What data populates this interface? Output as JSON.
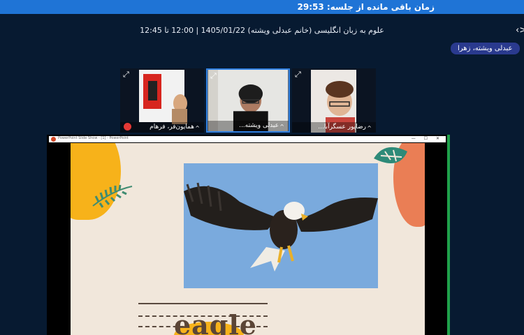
{
  "session": {
    "time_remaining": "زمان باقی مانده از جلسه: 29:53",
    "info": "علوم به زبان انگلیسی (خانم عبدلی ویشته) 1405/01/22 | 12:00 تا 12:45",
    "back_label": "‹>",
    "active_speaker": "عبدلی ویشته، زهرا"
  },
  "participants": [
    {
      "name": "همایون‌فر، فرهام",
      "icon": "expand-icon",
      "muted": true
    },
    {
      "name": "عبدلی ویشته...",
      "icon": "expand-icon",
      "active": true
    },
    {
      "name": "رضاپور عسگرآبا...",
      "icon": "expand-icon"
    }
  ],
  "shared_screen": {
    "app_title": "PowerPoint Slide Show - [1] - PowerPoint",
    "window_controls": "— ☐ ✕",
    "slide_word": "eagle"
  },
  "colors": {
    "topbar": "#1f74d6",
    "background": "#071a31",
    "accent": "#2f7fe0"
  }
}
